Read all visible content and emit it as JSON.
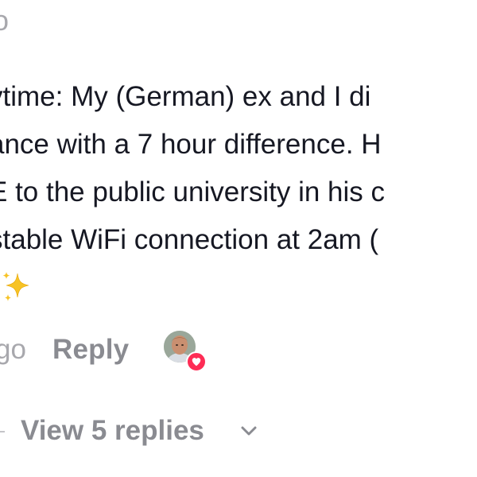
{
  "header": {
    "cutoff_char": "o"
  },
  "comment": {
    "lines": [
      "ytime: My (German) ex and I di",
      "ance with a 7 hour difference. H",
      "E to the public university in his c",
      "stable WiFi connection at 2am ("
    ],
    "emoji_icon": "sparkles-icon"
  },
  "meta": {
    "time_fragment": "go",
    "reply_label": "Reply",
    "liked_by_creator_icon": "heart-icon",
    "accent_color": "#fe2c55"
  },
  "replies": {
    "label": "View 5 replies",
    "icon": "chevron-down-icon"
  }
}
